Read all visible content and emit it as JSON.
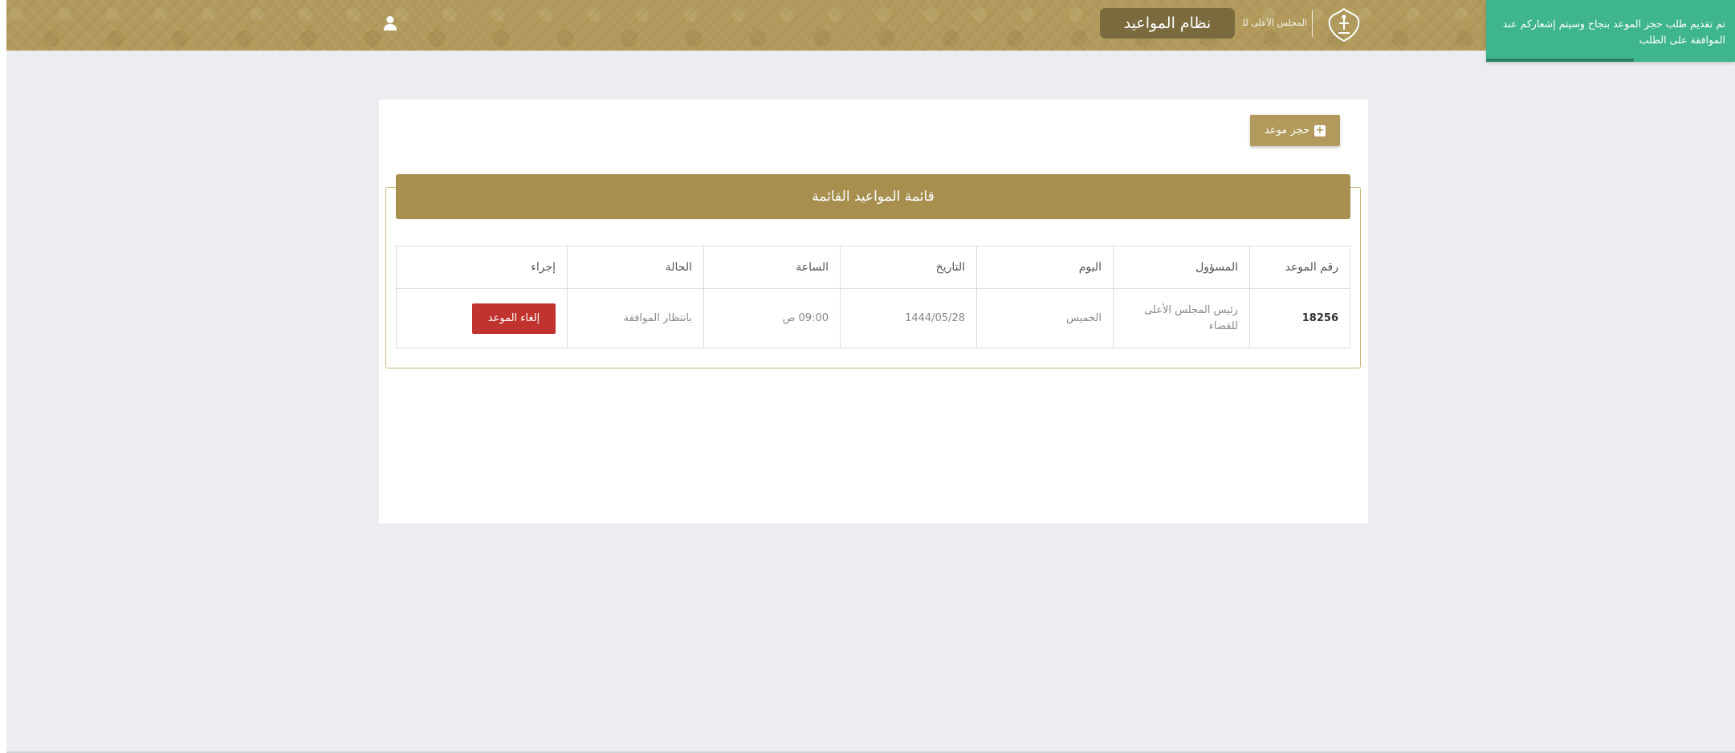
{
  "header": {
    "system_title": "نظام المواعيد",
    "logo_text": "المجلس الأعلى للقضاء",
    "background_color": "#b19a5b"
  },
  "toast": {
    "message": "تم تقديم طلب حجز الموعد بنجاح وسيتم إشعاركم عند الموافقة على الطلب",
    "background_color": "#3fb58e"
  },
  "toolbar": {
    "book_label": "حجز موعد"
  },
  "panel": {
    "title": "قائمة المواعيد القائمة"
  },
  "table": {
    "columns": [
      "رقم الموعد",
      "المسؤول",
      "اليوم",
      "التاريخ",
      "الساعة",
      "الحالة",
      "إجراء"
    ],
    "rows": [
      {
        "number": "18256",
        "official": "رئيس المجلس الأعلى للقضاء",
        "day": "الخميس",
        "date": "1444/05/28",
        "time": "09:00 ص",
        "status": "بانتظار الموافقة",
        "action_label": "إلغاء الموعد"
      }
    ]
  },
  "icons": {
    "user": "user-icon",
    "emblem": "emblem-icon",
    "plus": "plus-square-icon"
  }
}
